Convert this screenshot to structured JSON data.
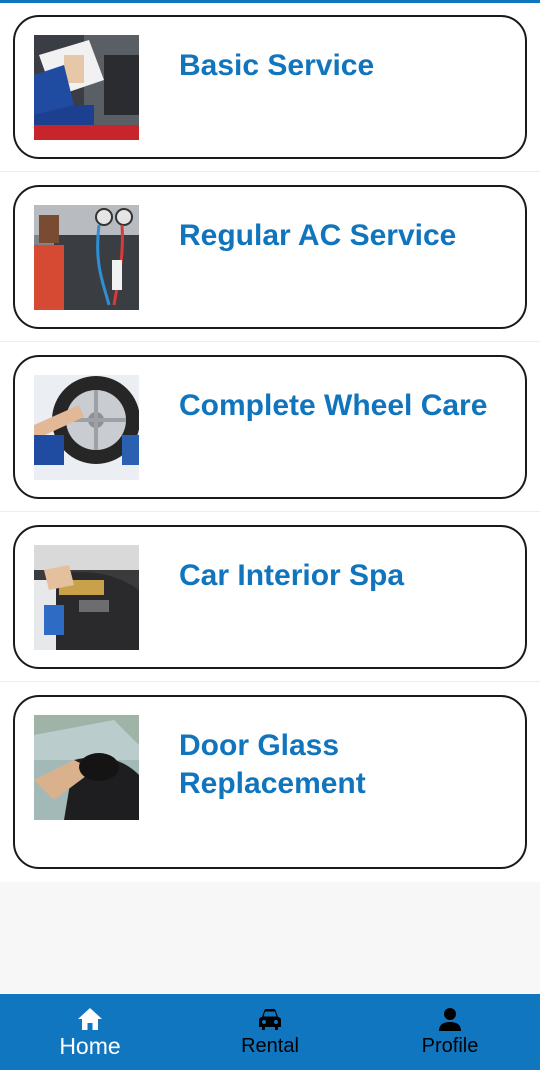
{
  "colors": {
    "accent": "#1175bd",
    "nav_background": "#1076c0",
    "card_border": "#1a1a1a"
  },
  "services": [
    {
      "title": "Basic Service",
      "icon": "mechanic-clipboard-photo"
    },
    {
      "title": "Regular AC Service",
      "icon": "ac-service-photo"
    },
    {
      "title": "Complete Wheel Care",
      "icon": "wheel-care-photo"
    },
    {
      "title": "Car Interior Spa",
      "icon": "interior-cleaning-photo"
    },
    {
      "title": "Door Glass Replacement",
      "icon": "door-glass-photo"
    }
  ],
  "bottom_nav": {
    "items": [
      {
        "label": "Home",
        "icon": "home-icon",
        "active": true
      },
      {
        "label": "Rental",
        "icon": "car-icon",
        "active": false
      },
      {
        "label": "Profile",
        "icon": "person-icon",
        "active": false
      }
    ]
  }
}
